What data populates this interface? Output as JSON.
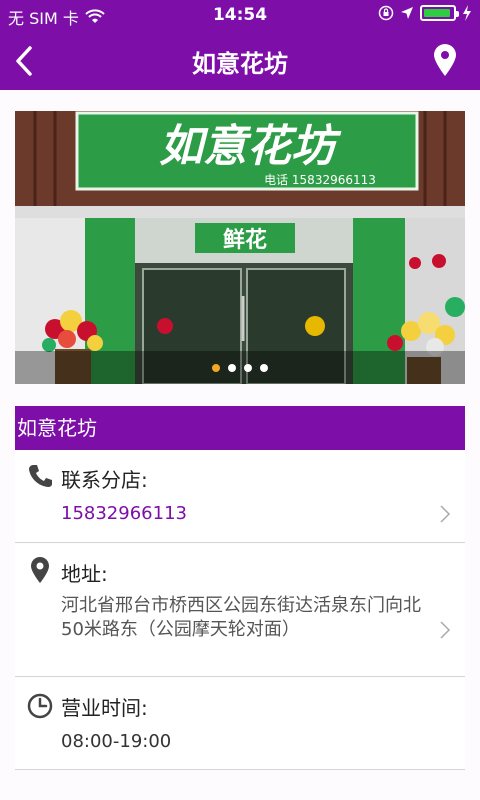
{
  "status_bar": {
    "carrier": "无 SIM 卡",
    "time": "14:54",
    "battery_level": 0.95,
    "battery_color": "#2ecc40"
  },
  "nav": {
    "title": "如意花坊",
    "back_icon": "chevron-left-icon",
    "location_icon": "map-pin-icon"
  },
  "banner": {
    "sign_text": "如意花坊",
    "sign_phone": "电话 15832966113",
    "door_sign": "鲜花",
    "slide_count": 4,
    "active_slide": 0,
    "active_dot_color": "#f5a623"
  },
  "shop": {
    "name": "如意花坊",
    "contact_label": "联系分店:",
    "phone": "15832966113",
    "address_label": "地址:",
    "address": "河北省邢台市桥西区公园东街达活泉东门向北50米路东（公园摩天轮对面）",
    "hours_label": "营业时间:",
    "hours": "08:00-19:00"
  },
  "colors": {
    "brand_purple": "#7d0ea8",
    "sign_green": "#2d9c46"
  }
}
